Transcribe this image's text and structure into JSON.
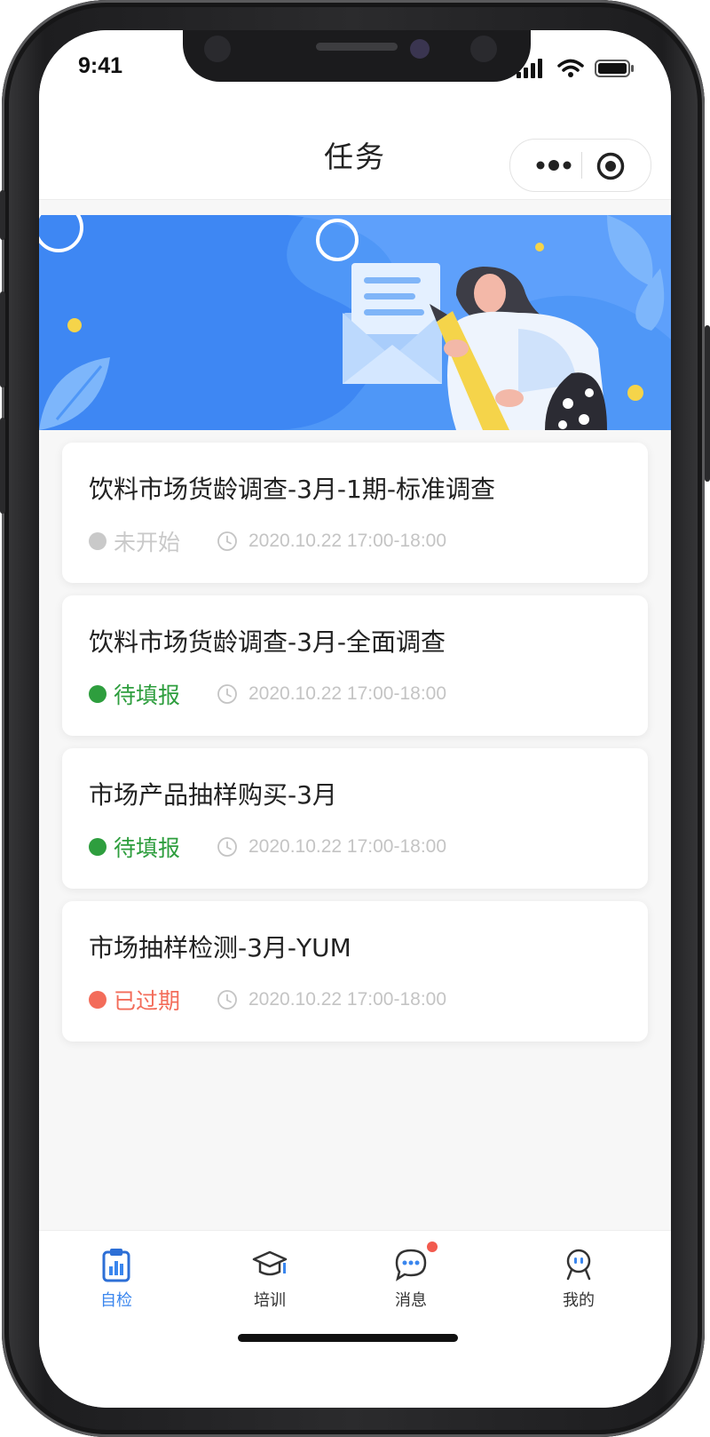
{
  "status_bar": {
    "time": "9:41"
  },
  "nav": {
    "title": "任务"
  },
  "tasks": [
    {
      "title": "饮料市场货龄调查-3月-1期-标准调查",
      "status": "未开始",
      "status_color": "#c9c9c9",
      "time": "2020.10.22 17:00-18:00"
    },
    {
      "title": "饮料市场货龄调查-3月-全面调查",
      "status": "待填报",
      "status_color": "#2e9e3e",
      "time": "2020.10.22 17:00-18:00"
    },
    {
      "title": "市场产品抽样购买-3月",
      "status": "待填报",
      "status_color": "#2e9e3e",
      "time": "2020.10.22 17:00-18:00"
    },
    {
      "title": "市场抽样检测-3月-YUM",
      "status": "已过期",
      "status_color": "#f36c5a",
      "time": "2020.10.22 17:00-18:00"
    }
  ],
  "tabs": [
    {
      "label": "自检",
      "icon": "clipboard-chart-icon",
      "active": true
    },
    {
      "label": "培训",
      "icon": "graduation-cap-icon",
      "active": false
    },
    {
      "label": "消息",
      "icon": "chat-bubble-icon",
      "active": false,
      "badge": true
    },
    {
      "label": "我的",
      "icon": "user-icon",
      "active": false
    }
  ],
  "colors": {
    "accent": "#3a86ee",
    "banner_blue": "#4f97f7",
    "pending_green": "#2e9e3e",
    "expired_red": "#f36c5a",
    "not_started_gray": "#c9c9c9"
  }
}
